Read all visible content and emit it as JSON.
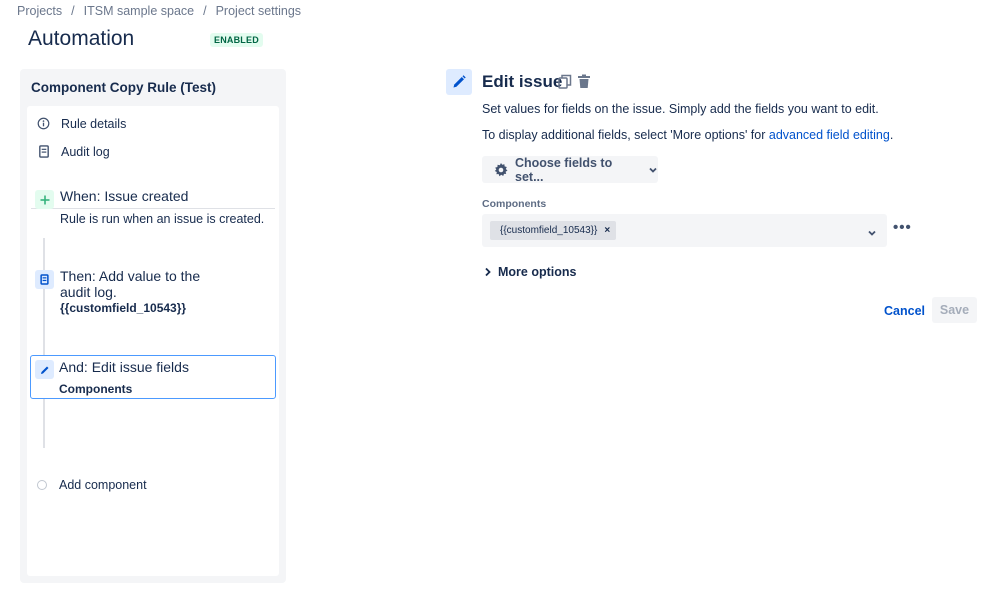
{
  "breadcrumb": {
    "items": [
      "Projects",
      "ITSM sample space",
      "Project settings"
    ],
    "separator": "/"
  },
  "page": {
    "title": "Automation",
    "status": "ENABLED"
  },
  "rule": {
    "name": "Component Copy Rule (Test)",
    "nav": [
      {
        "label": "Rule details",
        "icon": "info-icon"
      },
      {
        "label": "Audit log",
        "icon": "document-icon"
      }
    ],
    "steps": [
      {
        "title": "When: Issue created",
        "description": "Rule is run when an issue is created.",
        "icon": "plus-icon",
        "icon_color": "#36b37e"
      },
      {
        "title": "Then: Add value to the audit log.",
        "description": "{{customfield_10543}}",
        "icon": "document-icon",
        "icon_color": "#0052cc"
      },
      {
        "title": "And: Edit issue fields",
        "description": "Components",
        "icon": "pencil-icon",
        "icon_color": "#0052cc",
        "selected": true
      }
    ],
    "add_component_label": "Add component"
  },
  "editor": {
    "title": "Edit issue",
    "description": "Set values for fields on the issue. Simply add the fields you want to edit.",
    "hint_prefix": "To display additional fields, select 'More options' for ",
    "hint_link": "advanced field editing",
    "hint_suffix": ".",
    "choose_fields_label": "Choose fields to set...",
    "field": {
      "label": "Components",
      "selected_value": "{{customfield_10543}}"
    },
    "more_options_label": "More options",
    "cancel_label": "Cancel",
    "save_label": "Save"
  },
  "colors": {
    "accent": "#0052cc",
    "selected_border": "#4c9aff",
    "badge_bg": "#e3fcef",
    "badge_text": "#006644"
  }
}
